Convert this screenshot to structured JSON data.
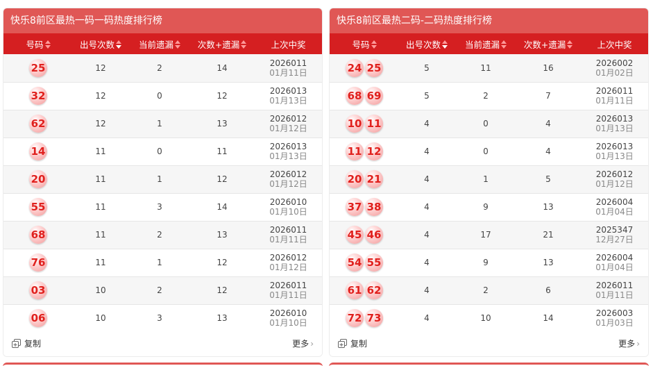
{
  "colors": {
    "title_bg": "#e05755",
    "header_bg": "#d51f21",
    "ball_text": "#e0201d"
  },
  "panels": [
    {
      "title": "快乐8前区最热一码一码热度排行榜",
      "headers": [
        "号码",
        "出号次数",
        "当前遗漏",
        "次数+遗漏",
        "上次中奖"
      ],
      "rows": [
        {
          "balls": [
            "25"
          ],
          "count": "12",
          "miss": "2",
          "sum": "14",
          "issue": "2026011",
          "date": "01月11日"
        },
        {
          "balls": [
            "32"
          ],
          "count": "12",
          "miss": "0",
          "sum": "12",
          "issue": "2026013",
          "date": "01月13日"
        },
        {
          "balls": [
            "62"
          ],
          "count": "12",
          "miss": "1",
          "sum": "13",
          "issue": "2026012",
          "date": "01月12日"
        },
        {
          "balls": [
            "14"
          ],
          "count": "11",
          "miss": "0",
          "sum": "11",
          "issue": "2026013",
          "date": "01月13日"
        },
        {
          "balls": [
            "20"
          ],
          "count": "11",
          "miss": "1",
          "sum": "12",
          "issue": "2026012",
          "date": "01月12日"
        },
        {
          "balls": [
            "55"
          ],
          "count": "11",
          "miss": "3",
          "sum": "14",
          "issue": "2026010",
          "date": "01月10日"
        },
        {
          "balls": [
            "68"
          ],
          "count": "11",
          "miss": "2",
          "sum": "13",
          "issue": "2026011",
          "date": "01月11日"
        },
        {
          "balls": [
            "76"
          ],
          "count": "11",
          "miss": "1",
          "sum": "12",
          "issue": "2026012",
          "date": "01月12日"
        },
        {
          "balls": [
            "03"
          ],
          "count": "10",
          "miss": "2",
          "sum": "12",
          "issue": "2026011",
          "date": "01月11日"
        },
        {
          "balls": [
            "06"
          ],
          "count": "10",
          "miss": "3",
          "sum": "13",
          "issue": "2026010",
          "date": "01月10日"
        }
      ],
      "copy_label": "复制",
      "more_label": "更多"
    },
    {
      "title": "快乐8前区最热二码-二码热度排行榜",
      "headers": [
        "号码",
        "出号次数",
        "当前遗漏",
        "次数+遗漏",
        "上次中奖"
      ],
      "rows": [
        {
          "balls": [
            "24",
            "25"
          ],
          "count": "5",
          "miss": "11",
          "sum": "16",
          "issue": "2026002",
          "date": "01月02日"
        },
        {
          "balls": [
            "68",
            "69"
          ],
          "count": "5",
          "miss": "2",
          "sum": "7",
          "issue": "2026011",
          "date": "01月11日"
        },
        {
          "balls": [
            "10",
            "11"
          ],
          "count": "4",
          "miss": "0",
          "sum": "4",
          "issue": "2026013",
          "date": "01月13日"
        },
        {
          "balls": [
            "11",
            "12"
          ],
          "count": "4",
          "miss": "0",
          "sum": "4",
          "issue": "2026013",
          "date": "01月13日"
        },
        {
          "balls": [
            "20",
            "21"
          ],
          "count": "4",
          "miss": "1",
          "sum": "5",
          "issue": "2026012",
          "date": "01月12日"
        },
        {
          "balls": [
            "37",
            "38"
          ],
          "count": "4",
          "miss": "9",
          "sum": "13",
          "issue": "2026004",
          "date": "01月04日"
        },
        {
          "balls": [
            "45",
            "46"
          ],
          "count": "4",
          "miss": "17",
          "sum": "21",
          "issue": "2025347",
          "date": "12月27日"
        },
        {
          "balls": [
            "54",
            "55"
          ],
          "count": "4",
          "miss": "9",
          "sum": "13",
          "issue": "2026004",
          "date": "01月04日"
        },
        {
          "balls": [
            "61",
            "62"
          ],
          "count": "4",
          "miss": "2",
          "sum": "6",
          "issue": "2026011",
          "date": "01月11日"
        },
        {
          "balls": [
            "72",
            "73"
          ],
          "count": "4",
          "miss": "10",
          "sum": "14",
          "issue": "2026003",
          "date": "01月03日"
        }
      ],
      "copy_label": "复制",
      "more_label": "更多"
    }
  ]
}
